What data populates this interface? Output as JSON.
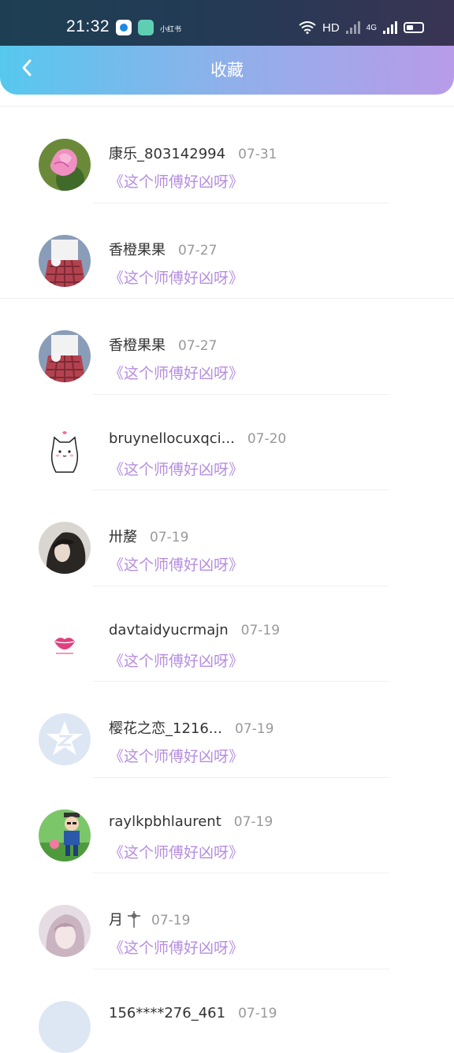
{
  "status_bar": {
    "time": "21:32",
    "mini_app_label": "小红书",
    "network_label": "HD",
    "network_type": "4G"
  },
  "nav": {
    "title": "收藏",
    "back_icon": "chevron-left-icon"
  },
  "colors": {
    "header_gradient_start": "#56c8ee",
    "header_gradient_end": "#b89be9",
    "subtitle_color": "#b68ee0"
  },
  "items": [
    {
      "name": "康乐_803142994",
      "date": "07-31",
      "subtitle": "《这个师傅好凶呀》",
      "avatar": "pink-rose-avatar"
    },
    {
      "name": "香橙果果",
      "date": "07-27",
      "subtitle": "《这个师傅好凶呀》",
      "avatar": "red-plaid-skirt-avatar"
    },
    {
      "name": "香橙果果",
      "date": "07-27",
      "subtitle": "《这个师傅好凶呀》",
      "avatar": "red-plaid-skirt-avatar"
    },
    {
      "name": "bruynellocuxqci...",
      "date": "07-20",
      "subtitle": "《这个师傅好凶呀》",
      "avatar": "cartoon-cat-avatar"
    },
    {
      "name": "卅嫠",
      "date": "07-19",
      "subtitle": "《这个师傅好凶呀》",
      "avatar": "dark-hair-girl-avatar"
    },
    {
      "name": "davtaidyucrmajn",
      "date": "07-19",
      "subtitle": "《这个师傅好凶呀》",
      "avatar": "pink-lips-avatar"
    },
    {
      "name": "樱花之恋_1216...",
      "date": "07-19",
      "subtitle": "《这个师傅好凶呀》",
      "avatar": "default-star-avatar"
    },
    {
      "name": "raylkpbhlaurent",
      "date": "07-19",
      "subtitle": "《这个师傅好凶呀》",
      "avatar": "cartoon-boy-avatar"
    },
    {
      "name": "月",
      "date": "07-19",
      "subtitle": "《这个师傅好凶呀》",
      "avatar": "anime-girl-avatar"
    }
  ],
  "partial_item": {
    "name": "156****276_461",
    "date": "07-19"
  }
}
